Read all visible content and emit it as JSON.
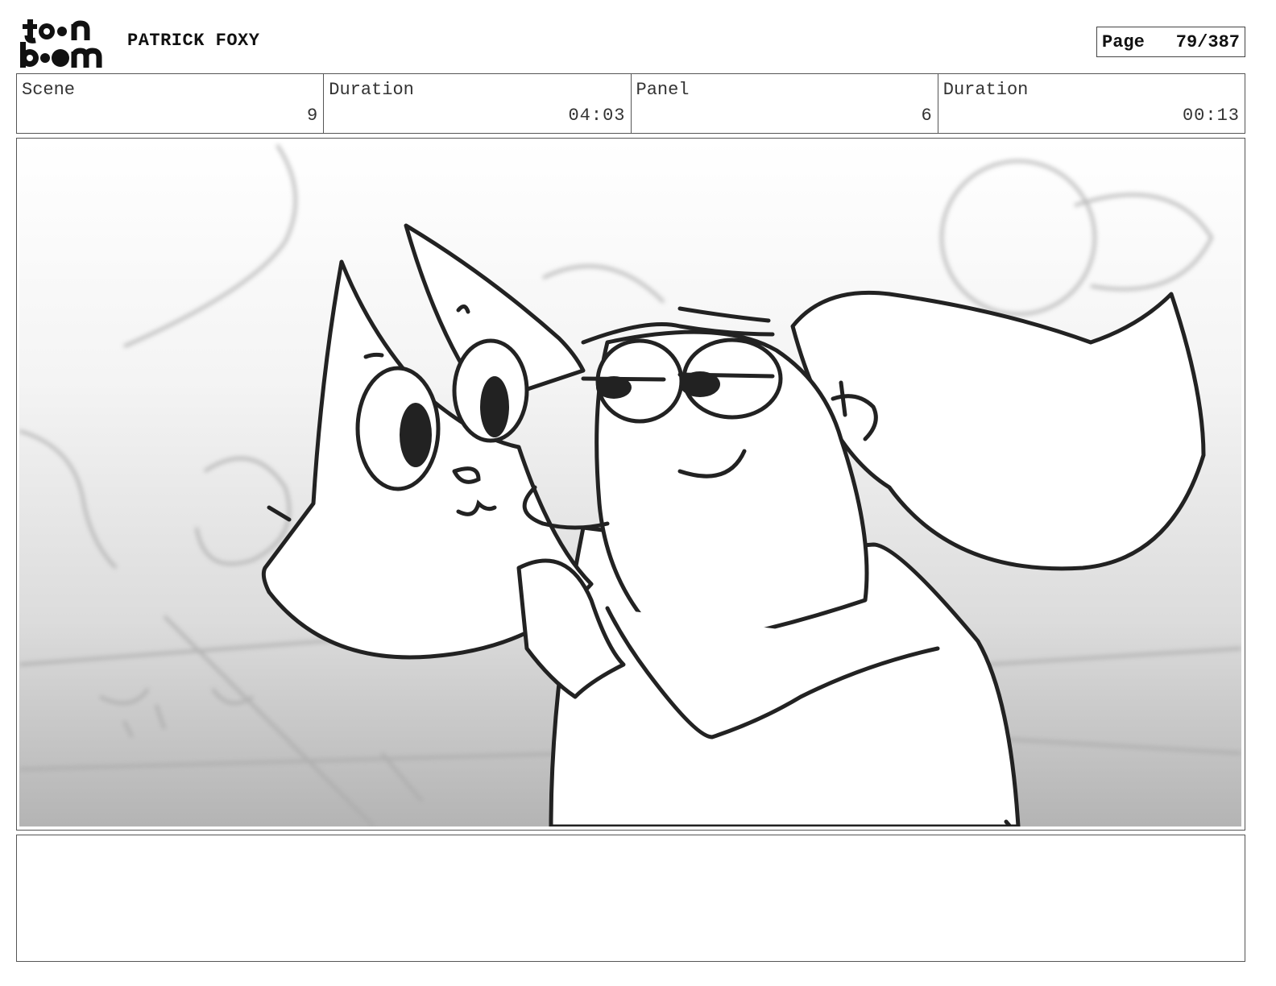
{
  "header": {
    "logo_alt": "toon boom",
    "project_title": "PATRICK FOXY",
    "page_label": "Page",
    "page_value": "79/387"
  },
  "info": {
    "scene_label": "Scene",
    "scene_value": "9",
    "scene_duration_label": "Duration",
    "scene_duration_value": "04:03",
    "panel_label": "Panel",
    "panel_value": "6",
    "panel_duration_label": "Duration",
    "panel_duration_value": "00:13"
  },
  "panel": {
    "image_description_icon": "storyboard-sketch"
  },
  "notes": {
    "text": ""
  }
}
